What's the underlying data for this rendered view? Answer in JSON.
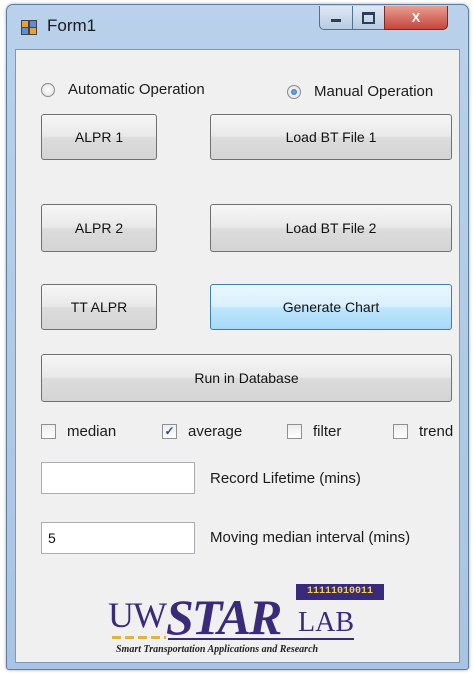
{
  "window": {
    "title": "Form1",
    "icon": "winforms-app-icon",
    "controls": {
      "minimize": "minimize-icon",
      "maximize": "maximize-icon",
      "close": "close-icon",
      "close_glyph": "X"
    }
  },
  "mode": {
    "automatic_label": "Automatic Operation",
    "manual_label": "Manual Operation",
    "selected": "manual"
  },
  "buttons": {
    "alpr1": "ALPR 1",
    "alpr2": "ALPR 2",
    "tt_alpr": "TT ALPR",
    "load_bt1": "Load BT File 1",
    "load_bt2": "Load BT File 2",
    "generate_chart": "Generate Chart",
    "run_db": "Run in Database"
  },
  "checkboxes": [
    {
      "label": "median",
      "checked": false
    },
    {
      "label": "average",
      "checked": true
    },
    {
      "label": "filter",
      "checked": false
    },
    {
      "label": "trend",
      "checked": false
    }
  ],
  "fields": {
    "record_lifetime": {
      "label": "Record Lifetime (mins)",
      "value": ""
    },
    "moving_median": {
      "label": "Moving median interval (mins)",
      "value": "5"
    }
  },
  "logo": {
    "uw": "UW",
    "star": "STAR",
    "lab": "LAB",
    "binary": "11111010011",
    "tagline": "Smart Transportation Applications and Research",
    "colors": {
      "primary": "#3a2a7a",
      "accent": "#f2d15b"
    }
  },
  "colors": {
    "focus_border": "#3c7fb1",
    "close_button": "#c6453a",
    "titlebar": "#b9d1ea"
  }
}
